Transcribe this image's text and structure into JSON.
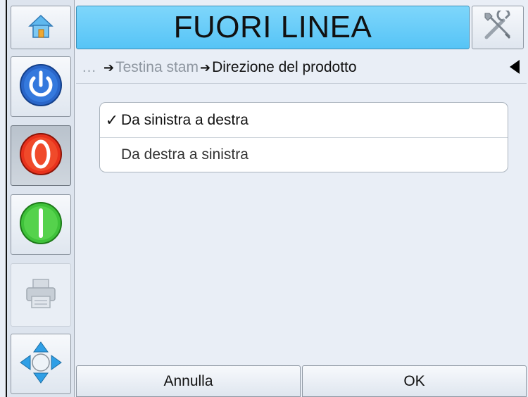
{
  "header": {
    "title": "FUORI LINEA",
    "title_bg": "#5ec8f7"
  },
  "rail": {
    "items": [
      {
        "icon": "home-icon"
      },
      {
        "icon": "power-icon",
        "color": "#2a66c9"
      },
      {
        "icon": "stop-icon",
        "color": "#e8321c"
      },
      {
        "icon": "start-icon",
        "color": "#3fc23a"
      },
      {
        "icon": "printer-icon"
      },
      {
        "icon": "navigate-icon",
        "color": "#2f9fe6"
      }
    ],
    "tools_icon": "tools-icon"
  },
  "breadcrumb": {
    "ellipsis": "…",
    "arrow": "➔",
    "parent": "Testina stam",
    "current": "Direzione del prodotto"
  },
  "options": {
    "check": "✓",
    "items": [
      {
        "label": "Da sinistra a destra",
        "selected": true
      },
      {
        "label": "Da destra a sinistra",
        "selected": false
      }
    ]
  },
  "footer": {
    "cancel_label": "Annulla",
    "ok_label": "OK"
  }
}
